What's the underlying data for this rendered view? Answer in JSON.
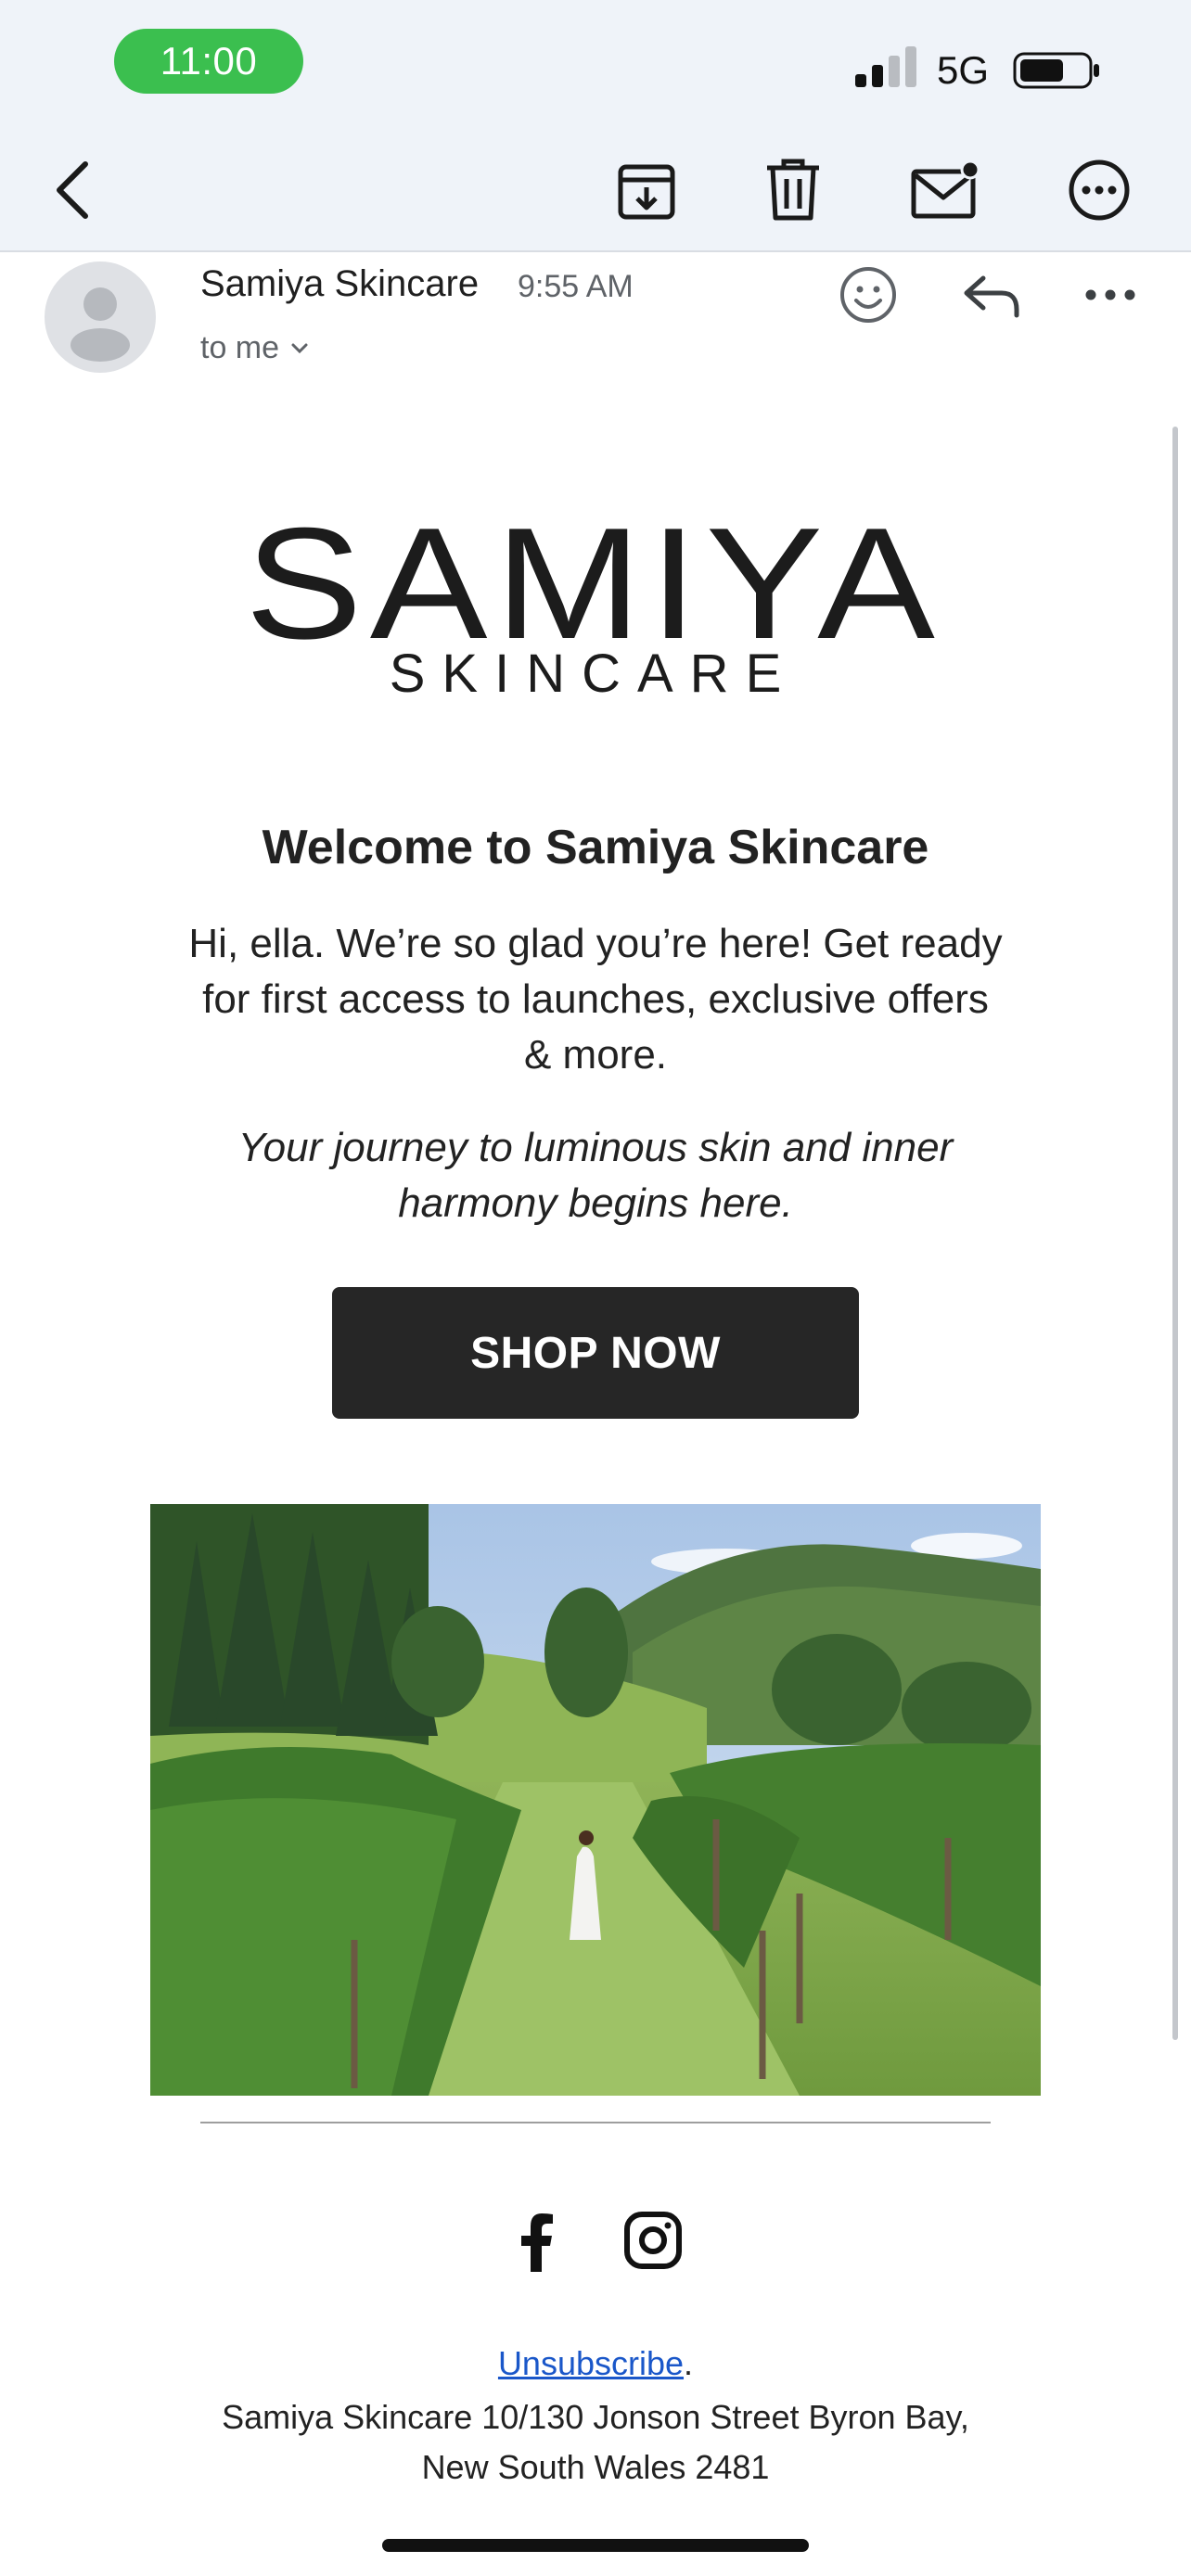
{
  "status_bar": {
    "time": "11:00",
    "network": "5G"
  },
  "toolbar": {
    "back_icon": "chevron-left-icon",
    "archive_icon": "archive-icon",
    "delete_icon": "trash-icon",
    "mark_unread_icon": "mail-unread-icon",
    "more_icon": "more-circle-icon"
  },
  "email_header": {
    "sender": "Samiya Skincare",
    "time": "9:55 AM",
    "recipient": "to me",
    "emoji_icon": "emoji-icon",
    "reply_icon": "reply-icon",
    "more_icon": "more-horizontal-icon"
  },
  "email_body": {
    "logo": {
      "brand": "SAMIYA",
      "sub": "SKINCARE"
    },
    "heading": "Welcome to Samiya Skincare",
    "intro": "Hi, ella. We’re so glad you’re here! Get ready for first access to launches, exclusive offers & more.",
    "tagline": "Your journey to luminous skin and inner harmony begins here.",
    "cta_label": "SHOP NOW"
  },
  "footer": {
    "social_icons": [
      "facebook-icon",
      "instagram-icon"
    ],
    "unsubscribe_label": "Unsubscribe",
    "unsubscribe_suffix": ".",
    "address_line1": "Samiya Skincare 10/130 Jonson Street Byron Bay,",
    "address_line2": "New South Wales 2481"
  },
  "colors": {
    "status_pill": "#3bbf4f",
    "top_bar_bg": "#eff3f9",
    "cta_bg": "#262626",
    "link": "#1a57c9"
  }
}
